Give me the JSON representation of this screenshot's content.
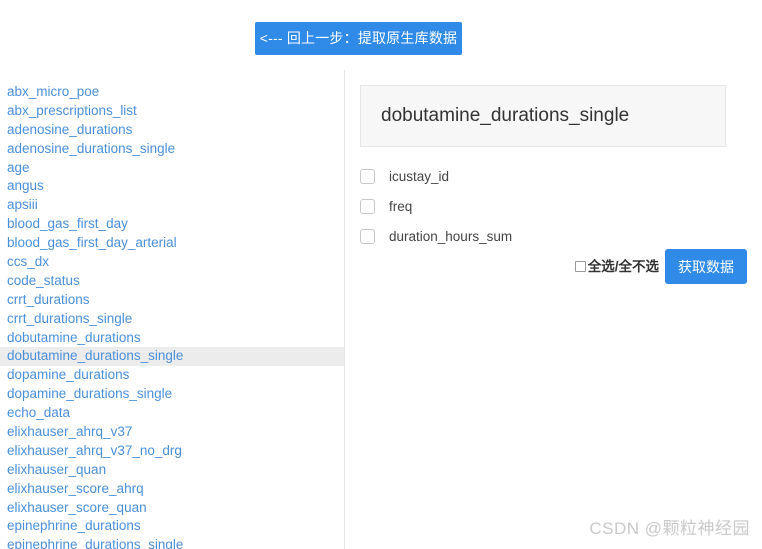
{
  "colors": {
    "accent_blue": "#2f8ae8",
    "link_blue": "#4a90d9",
    "selected_row_bg": "#ececec",
    "panel_bg": "#f7f7f7",
    "watermark": "#c9c9c9"
  },
  "top_bar": {
    "back_button_label": "<--- 回上一步：提取原生库数据"
  },
  "sidebar": {
    "selected_item": "dobutamine_durations_single",
    "items": [
      "abx_micro_poe",
      "abx_prescriptions_list",
      "adenosine_durations",
      "adenosine_durations_single",
      "age",
      "angus",
      "apsiii",
      "blood_gas_first_day",
      "blood_gas_first_day_arterial",
      "ccs_dx",
      "code_status",
      "crrt_durations",
      "crrt_durations_single",
      "dobutamine_durations",
      "dobutamine_durations_single",
      "dopamine_durations",
      "dopamine_durations_single",
      "echo_data",
      "elixhauser_ahrq_v37",
      "elixhauser_ahrq_v37_no_drg",
      "elixhauser_quan",
      "elixhauser_score_ahrq",
      "elixhauser_score_quan",
      "epinephrine_durations",
      "epinephrine_durations_single"
    ]
  },
  "detail": {
    "table_name": "dobutamine_durations_single",
    "columns": [
      {
        "name": "icustay_id",
        "checked": false
      },
      {
        "name": "freq",
        "checked": false
      },
      {
        "name": "duration_hours_sum",
        "checked": false
      }
    ],
    "select_all_label": "全选/全不选",
    "select_all_checked": false,
    "fetch_button_label": "获取数据"
  },
  "watermark": {
    "text": "CSDN @颗粒神经园"
  }
}
